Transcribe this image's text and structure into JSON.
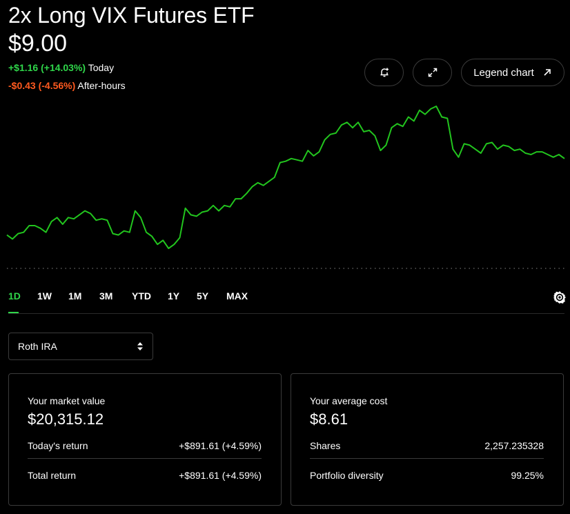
{
  "header": {
    "title": "2x Long VIX Futures ETF",
    "price": "$9.00",
    "today_change": "+$1.16 (+14.03%)",
    "today_label": "Today",
    "after_hours_change": "-$0.43 (-4.56%)",
    "after_hours_label": "After-hours"
  },
  "toolbar": {
    "alert_icon": "bell-plus-icon",
    "expand_icon": "expand-icon",
    "legend_label": "Legend chart",
    "legend_icon": "arrow-up-right-icon"
  },
  "colors": {
    "positive": "#2fd64a",
    "negative": "#ff5a1f",
    "line": "#22c51e",
    "background": "#000000"
  },
  "chart_data": {
    "type": "line",
    "baseline": "dotted",
    "values": [
      6.6,
      6.3,
      6.7,
      6.8,
      7.3,
      7.3,
      7.1,
      6.8,
      7.6,
      7.9,
      7.4,
      7.9,
      7.8,
      8.1,
      8.4,
      8.2,
      7.7,
      7.8,
      7.7,
      6.7,
      6.6,
      6.9,
      6.8,
      8.4,
      7.9,
      6.8,
      6.5,
      5.9,
      6.2,
      5.6,
      5.9,
      6.4,
      8.6,
      8.1,
      8.0,
      8.3,
      8.4,
      8.8,
      8.4,
      8.8,
      8.7,
      9.3,
      9.3,
      9.7,
      10.2,
      10.5,
      10.3,
      10.6,
      10.9,
      12.0,
      12.1,
      12.3,
      12.2,
      12.1,
      12.9,
      12.5,
      12.8,
      13.7,
      14.1,
      14.2,
      14.8,
      15.0,
      14.6,
      15.0,
      14.3,
      14.4,
      14.0,
      12.9,
      13.3,
      14.6,
      14.9,
      14.7,
      15.4,
      15.1,
      15.9,
      15.6,
      16.0,
      16.2,
      15.4,
      15.3,
      13.0,
      12.4,
      13.4,
      13.3,
      13.0,
      12.7,
      13.4,
      13.5,
      13.0,
      13.3,
      13.2,
      12.9,
      13.0,
      12.7,
      12.6,
      12.8,
      12.8,
      12.6,
      12.4,
      12.6,
      12.3
    ]
  },
  "ranges": {
    "items": [
      "1D",
      "1W",
      "1M",
      "3M",
      "YTD",
      "1Y",
      "5Y",
      "MAX"
    ],
    "active": "1D",
    "settings_icon": "gear-icon"
  },
  "account_select": {
    "value": "Roth IRA",
    "icon": "chevron-up-down-icon"
  },
  "market_card": {
    "label": "Your market value",
    "value": "$20,315.12",
    "rows": [
      {
        "label": "Today's return",
        "value": "+$891.61 (+4.59%)"
      },
      {
        "label": "Total return",
        "value": "+$891.61 (+4.59%)"
      }
    ]
  },
  "cost_card": {
    "label": "Your average cost",
    "value": "$8.61",
    "rows": [
      {
        "label": "Shares",
        "value": "2,257.235328"
      },
      {
        "label": "Portfolio diversity",
        "value": "99.25%"
      }
    ]
  }
}
